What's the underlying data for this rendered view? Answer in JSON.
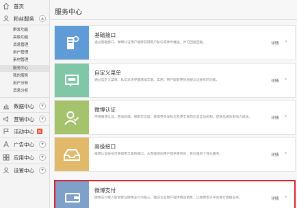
{
  "sidebar": {
    "home": "首页",
    "fans": "粉丝服务",
    "fans_sub": [
      "群发功能",
      "高级功能",
      "消息管理",
      "用户管理",
      "素材管理",
      "服务中心",
      "我的服务",
      "用户分析",
      "消息分析"
    ],
    "active_index": 5,
    "data": "数据中心",
    "marketing": "营销中心",
    "activity": "活动中心",
    "activity_badge": "新",
    "ads": "广告中心",
    "apps": "应用中心",
    "settings": "设置中心"
  },
  "main": {
    "title": "服务中心",
    "detail_label": "详情",
    "cards": [
      {
        "title": "基础接口",
        "desc": "通过基础接口，微博认证用户能够获得用户私信或事件推送，并可回复回复。",
        "color": "#5f9bd6"
      },
      {
        "title": "自定义菜单",
        "desc": "通过自定义菜单，私信对话界面增加丰富、实用，用户能够更快地捷认证账号的功能。",
        "color": "#7fc7a7"
      },
      {
        "title": "微博认证",
        "desc": "申请微博认证，更加权威，搜索可信度，获得更多发私信及更丰富的信息互动机制，促进品牌及影响力成长。",
        "color": "#a5c36d"
      },
      {
        "title": "高级接口",
        "desc": "微博认证账号可获得更丰富的接口，从而能够向用户提供更有效，有价值的个性化服务。",
        "color": "#e0b96a"
      },
      {
        "title": "微博支付",
        "desc": "微博支付接入能够登记微博支付为核心，面向企业用户提供商品销售，让微博电子平台进行收银业务。",
        "color": "#7fa0c8"
      }
    ]
  }
}
